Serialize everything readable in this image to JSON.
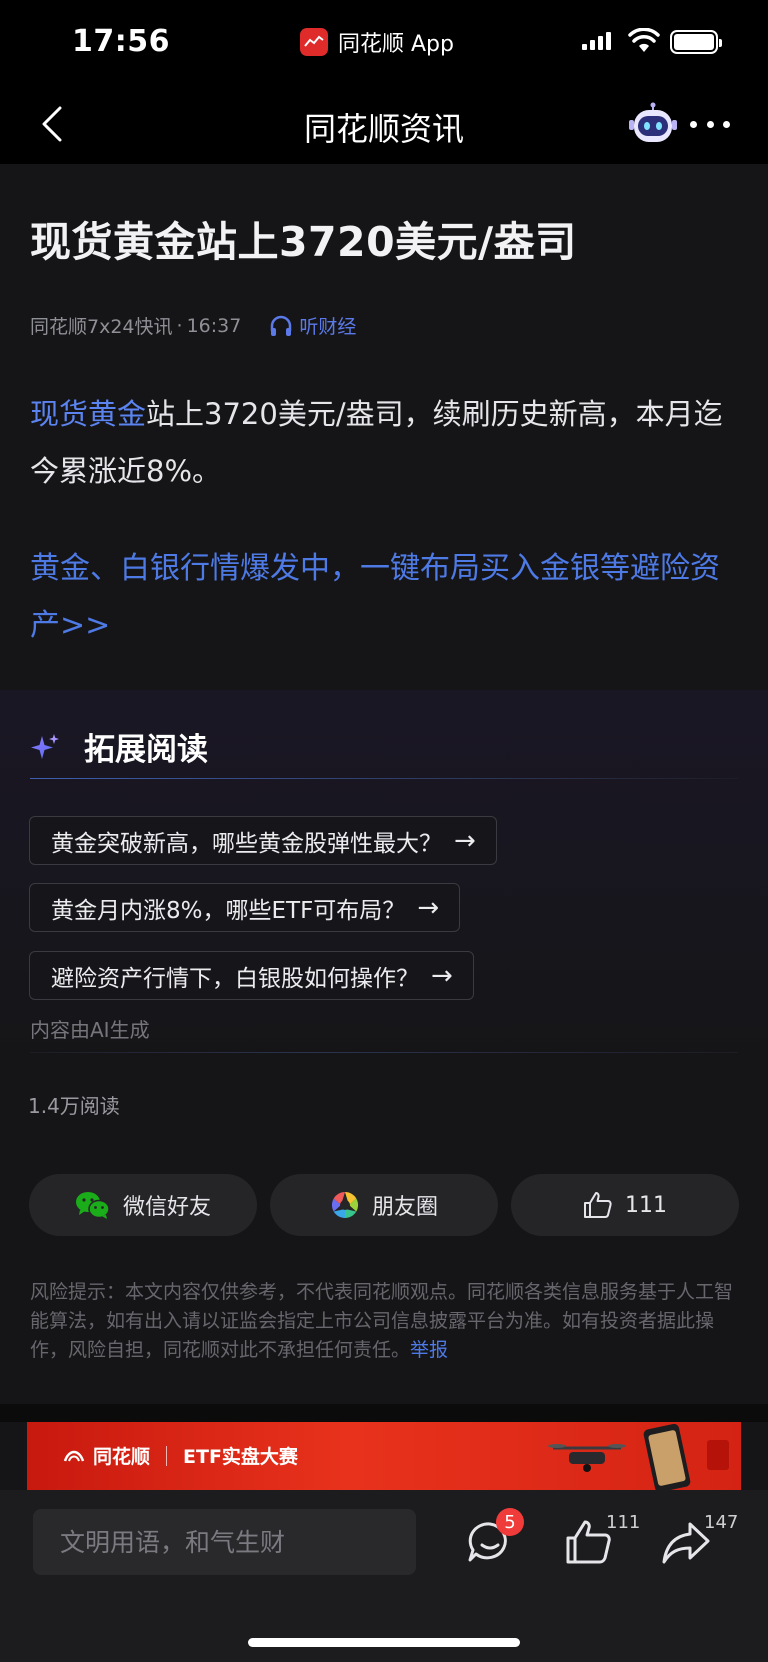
{
  "status_bar": {
    "time": "17:56",
    "app_name": "同花顺 App"
  },
  "nav": {
    "title": "同花顺资讯"
  },
  "article": {
    "headline": "现货黄金站上3720美元/盎司",
    "source": "同花顺7x24快讯",
    "time": "16:37",
    "listen_label": "听财经",
    "body_highlight": "现货黄金",
    "body_rest": "站上3720美元/盎司，续刷历史新高，本月迄今累涨近8%。",
    "promo_link": "黄金、白银行情爆发中，一键布局买入金银等避险资产>>"
  },
  "extended_reading": {
    "title": "拓展阅读",
    "questions": [
      "黄金突破新高，哪些黄金股弹性最大？",
      "黄金月内涨8%，哪些ETF可布局？",
      "避险资产行情下，白银股如何操作？"
    ],
    "ai_note": "内容由AI生成"
  },
  "reads": "1.4万阅读",
  "share": {
    "wechat_label": "微信好友",
    "moments_label": "朋友圈",
    "like_count": "111"
  },
  "risk": {
    "text": "风险提示：本文内容仅供参考，不代表同花顺观点。同花顺各类信息服务基于人工智能算法，如有出入请以证监会指定上市公司信息披露平台为准。如有投资者据此操作，风险自担，同花顺对此不承担任何责任。",
    "report_label": "举报"
  },
  "banner": {
    "brand": "同花顺",
    "event": "ETF实盘大赛"
  },
  "bottom_bar": {
    "input_placeholder": "文明用语，和气生财",
    "comment_badge": "5",
    "like_count": "111",
    "share_count": "147"
  },
  "colors": {
    "accent_blue": "#4e7ae6",
    "badge_red": "#f03b3b",
    "wechat_green": "#1aad19"
  }
}
